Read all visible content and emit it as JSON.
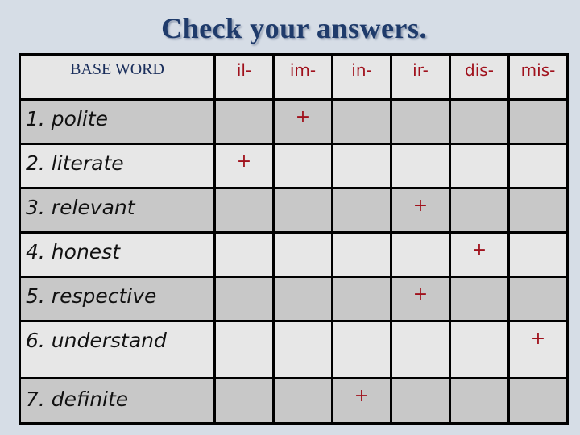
{
  "title": "Check your answers.",
  "table": {
    "headers": [
      "BASE WORD",
      "il-",
      "im-",
      "in-",
      "ir-",
      "dis-",
      "mis-"
    ],
    "rows": [
      {
        "word": "1. polite",
        "marks": [
          "",
          "+",
          "",
          "",
          "",
          ""
        ]
      },
      {
        "word": "2. literate",
        "marks": [
          "+",
          "",
          "",
          "",
          "",
          ""
        ]
      },
      {
        "word": "3. relevant",
        "marks": [
          "",
          "",
          "",
          "+",
          "",
          ""
        ]
      },
      {
        "word": "4. honest",
        "marks": [
          "",
          "",
          "",
          "",
          "+",
          ""
        ]
      },
      {
        "word": "5. respective",
        "marks": [
          "",
          "",
          "",
          "+",
          "",
          ""
        ]
      },
      {
        "word": "6. understand",
        "marks": [
          "",
          "",
          "",
          "",
          "",
          "+"
        ]
      },
      {
        "word": "7. definite",
        "marks": [
          "",
          "",
          "+",
          "",
          "",
          ""
        ]
      }
    ]
  },
  "colors": {
    "background": "#d6dde6",
    "title": "#1f3b6b",
    "prefix_header": "#a0111c",
    "mark": "#a0111c",
    "row_dark": "#c8c8c8",
    "row_light": "#e7e7e7"
  }
}
